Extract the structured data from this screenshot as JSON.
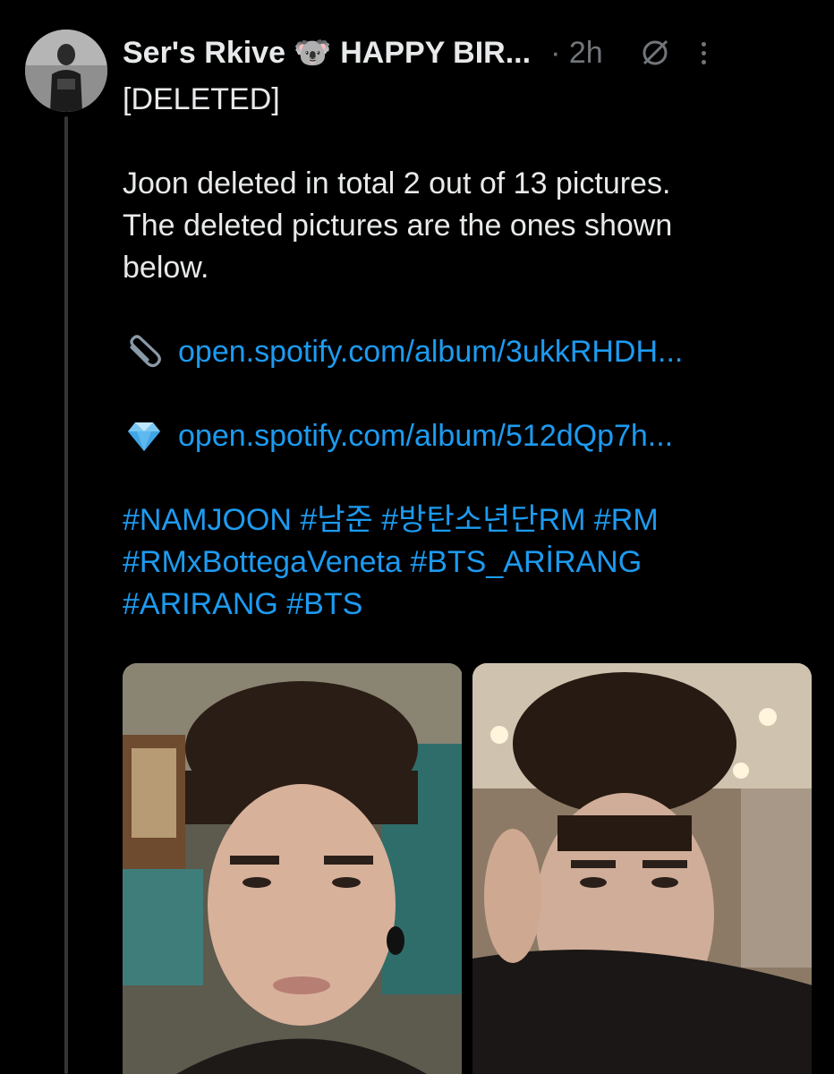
{
  "tweet": {
    "display_name": "Ser's Rkive 🐨 HAPPY BIR...",
    "time": "· 2h",
    "lines": [
      "[DELETED]",
      "",
      "Joon deleted in total 2 out of 13 pictures.",
      "The deleted pictures are the ones shown",
      "below."
    ],
    "links": [
      {
        "emoji": "paperclip-icon",
        "text": "open.spotify.com/album/3ukkRHDH..."
      },
      {
        "emoji": "gem-icon",
        "text": "open.spotify.com/album/512dQp7h..."
      }
    ],
    "hashtag_lines": [
      "#NAMJOON #남준 #방탄소년단RM #RM",
      "#RMxBottegaVeneta #BTS_ARİRANG",
      "#ARIRANG #BTS"
    ]
  },
  "colors": {
    "background": "#000000",
    "text": "#e7e9ea",
    "muted": "#71767b",
    "link": "#1d9bf0"
  }
}
